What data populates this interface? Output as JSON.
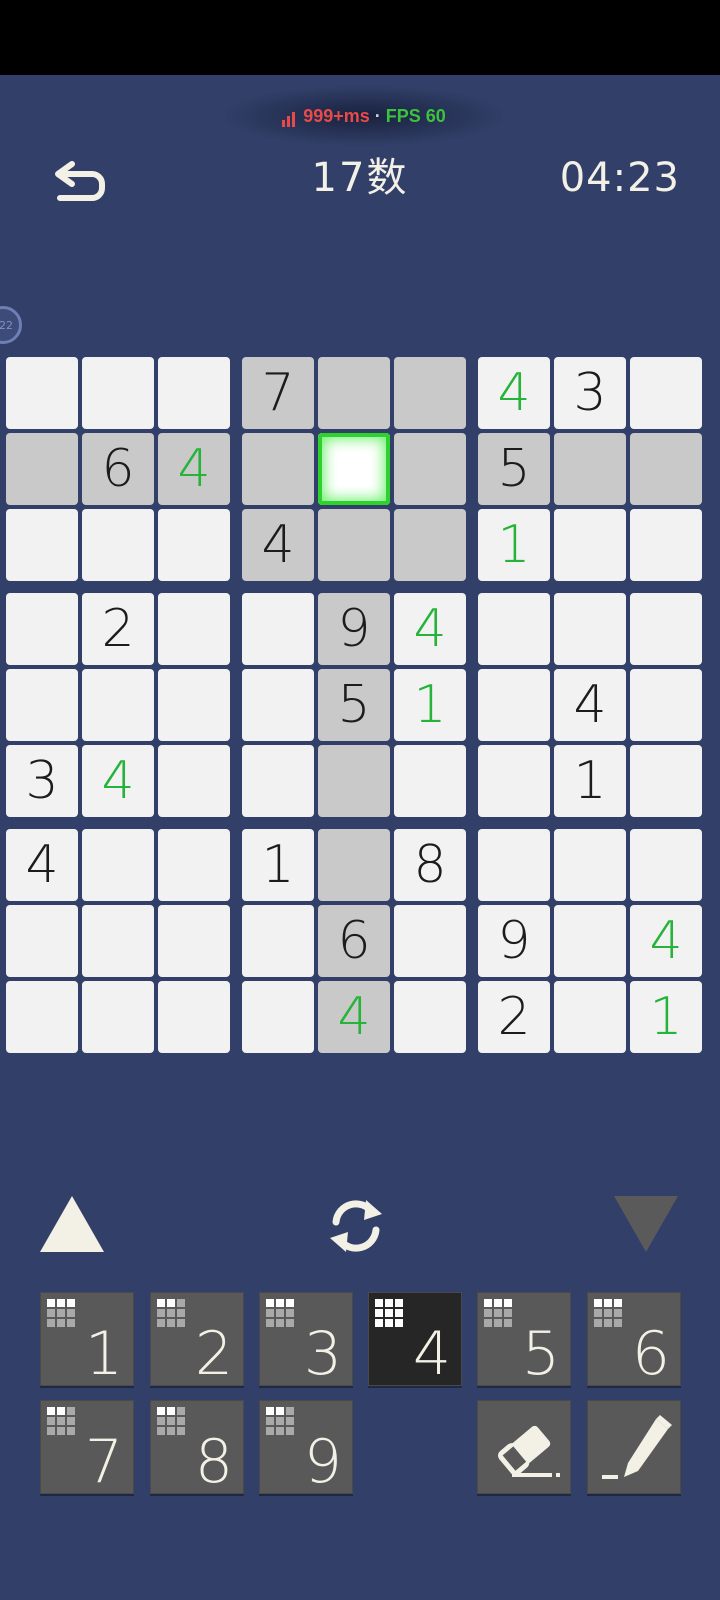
{
  "perf": {
    "latency": "999+ms",
    "separator": "·",
    "fps": "FPS 60"
  },
  "header": {
    "title": "17数",
    "timer": "04:23"
  },
  "bubble": {
    "label": "22"
  },
  "board": {
    "givens": [
      [
        0,
        0,
        0,
        7,
        0,
        0,
        0,
        3,
        0
      ],
      [
        0,
        6,
        0,
        0,
        0,
        0,
        5,
        0,
        0
      ],
      [
        0,
        0,
        0,
        4,
        0,
        0,
        0,
        0,
        0
      ],
      [
        0,
        2,
        0,
        0,
        9,
        0,
        0,
        0,
        0
      ],
      [
        0,
        0,
        0,
        0,
        5,
        0,
        0,
        4,
        0
      ],
      [
        3,
        0,
        0,
        0,
        0,
        0,
        0,
        1,
        0
      ],
      [
        4,
        0,
        0,
        1,
        0,
        8,
        0,
        0,
        0
      ],
      [
        0,
        0,
        0,
        0,
        6,
        0,
        9,
        0,
        0
      ],
      [
        0,
        0,
        0,
        0,
        0,
        0,
        2,
        0,
        0
      ]
    ],
    "entries": [
      [
        0,
        0,
        0,
        0,
        0,
        0,
        4,
        0,
        0
      ],
      [
        0,
        0,
        4,
        0,
        0,
        0,
        0,
        0,
        0
      ],
      [
        0,
        0,
        0,
        0,
        0,
        0,
        1,
        0,
        0
      ],
      [
        0,
        0,
        0,
        0,
        0,
        4,
        0,
        0,
        0
      ],
      [
        0,
        0,
        0,
        0,
        0,
        1,
        0,
        0,
        0
      ],
      [
        0,
        4,
        0,
        0,
        0,
        0,
        0,
        0,
        0
      ],
      [
        0,
        0,
        0,
        0,
        0,
        0,
        0,
        0,
        0
      ],
      [
        0,
        0,
        0,
        0,
        0,
        0,
        0,
        0,
        4
      ],
      [
        0,
        0,
        0,
        0,
        4,
        0,
        0,
        0,
        1
      ]
    ],
    "selected": [
      1,
      4
    ]
  },
  "keypad": {
    "keys": [
      "1",
      "2",
      "3",
      "4",
      "5",
      "6",
      "7",
      "8",
      "9"
    ],
    "active_key": "4",
    "placed_counts": [
      3,
      2,
      3,
      9,
      3,
      3,
      2,
      2,
      2
    ]
  },
  "colors": {
    "background": "#324069",
    "cell": "#f2f2f2",
    "highlight": "#c9c9c9",
    "user_digit": "#25b33a",
    "selection": "#2fd12f"
  },
  "icons": {
    "back": "undo-arrow-icon",
    "refresh": "refresh-icon",
    "eraser": "eraser-icon",
    "pencil": "pencil-icon"
  }
}
